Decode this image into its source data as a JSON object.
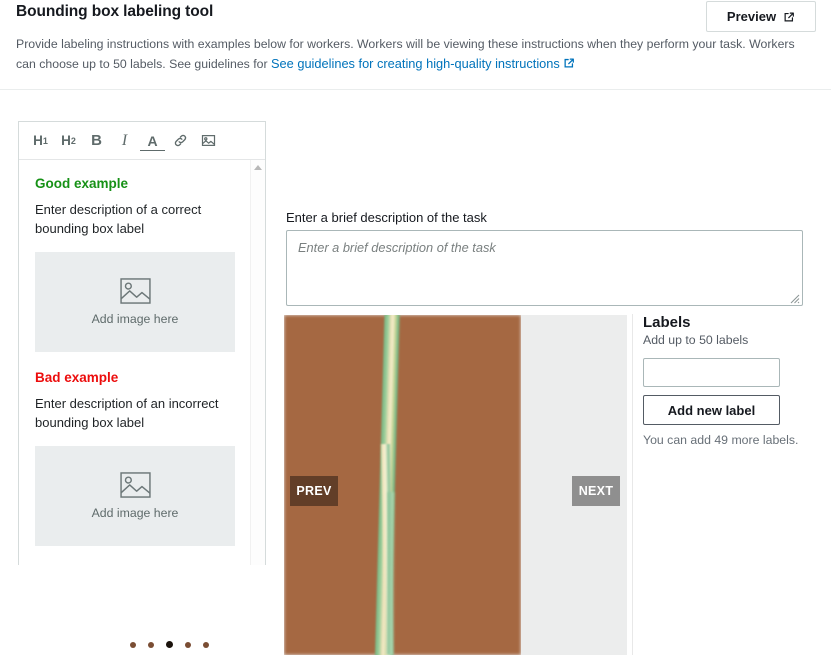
{
  "header": {
    "title": "Bounding box labeling tool",
    "preview_label": "Preview",
    "preview_icon": "external-link-icon",
    "description_part1": "Provide labeling instructions with examples below for workers. Workers will be viewing these instructions when they perform your task. Workers can choose up to 50 labels. See guidelines for ",
    "link_text": "See guidelines for creating high-quality instructions",
    "link_color": "#0073bb"
  },
  "editor": {
    "toolbar": [
      {
        "name": "heading-1-button",
        "label": "H",
        "sub": "1"
      },
      {
        "name": "heading-2-button",
        "label": "H",
        "sub": "2"
      },
      {
        "name": "bold-button",
        "label": "B"
      },
      {
        "name": "italic-button",
        "label": "I"
      },
      {
        "name": "underline-button",
        "label": "A"
      },
      {
        "name": "link-icon",
        "label": "link"
      },
      {
        "name": "image-icon",
        "label": "image"
      }
    ],
    "good": {
      "heading": "Good example",
      "heading_color": "#169116",
      "text": "Enter description of a correct bounding box label",
      "dropzone_label": "Add image here"
    },
    "bad": {
      "heading": "Bad example",
      "heading_color": "#ec0d0d",
      "text": "Enter description of an incorrect bounding box label",
      "dropzone_label": "Add image here"
    }
  },
  "task": {
    "description_label": "Enter a brief description of the task",
    "description_placeholder": "Enter a brief description of the task",
    "description_value": ""
  },
  "carousel": {
    "prev_label": "PREV",
    "next_label": "NEXT",
    "dot_count": 5,
    "active_dot_index": 2,
    "image_alt": "blurred photo of a green plant stem on brown soil"
  },
  "labels": {
    "title": "Labels",
    "subtitle": "Add up to 50 labels",
    "input_value": "",
    "input_placeholder": "",
    "add_button_label": "Add new label",
    "hint": "You can add 49 more labels."
  }
}
